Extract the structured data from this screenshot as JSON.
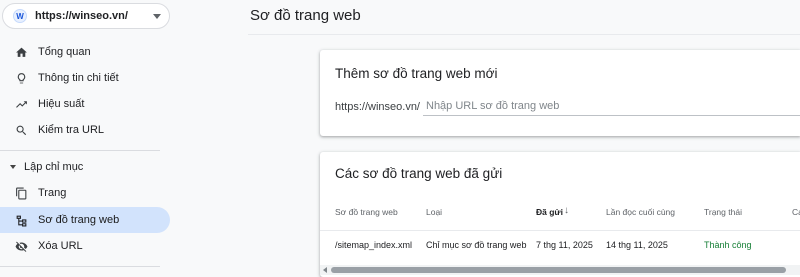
{
  "property": {
    "label": "https://winseo.vn/",
    "logo_letter": "W"
  },
  "sidebar": {
    "items": [
      {
        "label": "Tổng quan",
        "icon": "home-icon"
      },
      {
        "label": "Thông tin chi tiết",
        "icon": "lightbulb-icon"
      },
      {
        "label": "Hiệu suất",
        "icon": "trending-up-icon"
      },
      {
        "label": "Kiểm tra URL",
        "icon": "search-icon"
      }
    ],
    "section": "Lập chỉ mục",
    "index_items": [
      {
        "label": "Trang",
        "icon": "pages-icon"
      },
      {
        "label": "Sơ đồ trang web",
        "icon": "sitemap-icon",
        "active": true
      },
      {
        "label": "Xóa URL",
        "icon": "visibility-off-icon"
      }
    ]
  },
  "main": {
    "title": "Sơ đồ trang web",
    "add_card": {
      "title": "Thêm sơ đồ trang web mới",
      "url_prefix": "https://winseo.vn/",
      "input_placeholder": "Nhập URL sơ đồ trang web",
      "input_value": ""
    },
    "submitted_card": {
      "title": "Các sơ đồ trang web đã gửi",
      "columns": [
        "Sơ đồ trang web",
        "Loại",
        "Đã gửi",
        "Lần đọc cuối cùng",
        "Trạng thái",
        "Cá"
      ],
      "sorted_column": "Đã gửi",
      "rows": [
        [
          "/sitemap_index.xml",
          "Chỉ mục sơ đồ trang web",
          "7 thg 11, 2025",
          "14 thg 11, 2025",
          "Thành công"
        ]
      ]
    }
  },
  "colors": {
    "active_nav": "#d2e3fc",
    "success": "#188038",
    "brand": "#1a56db"
  }
}
